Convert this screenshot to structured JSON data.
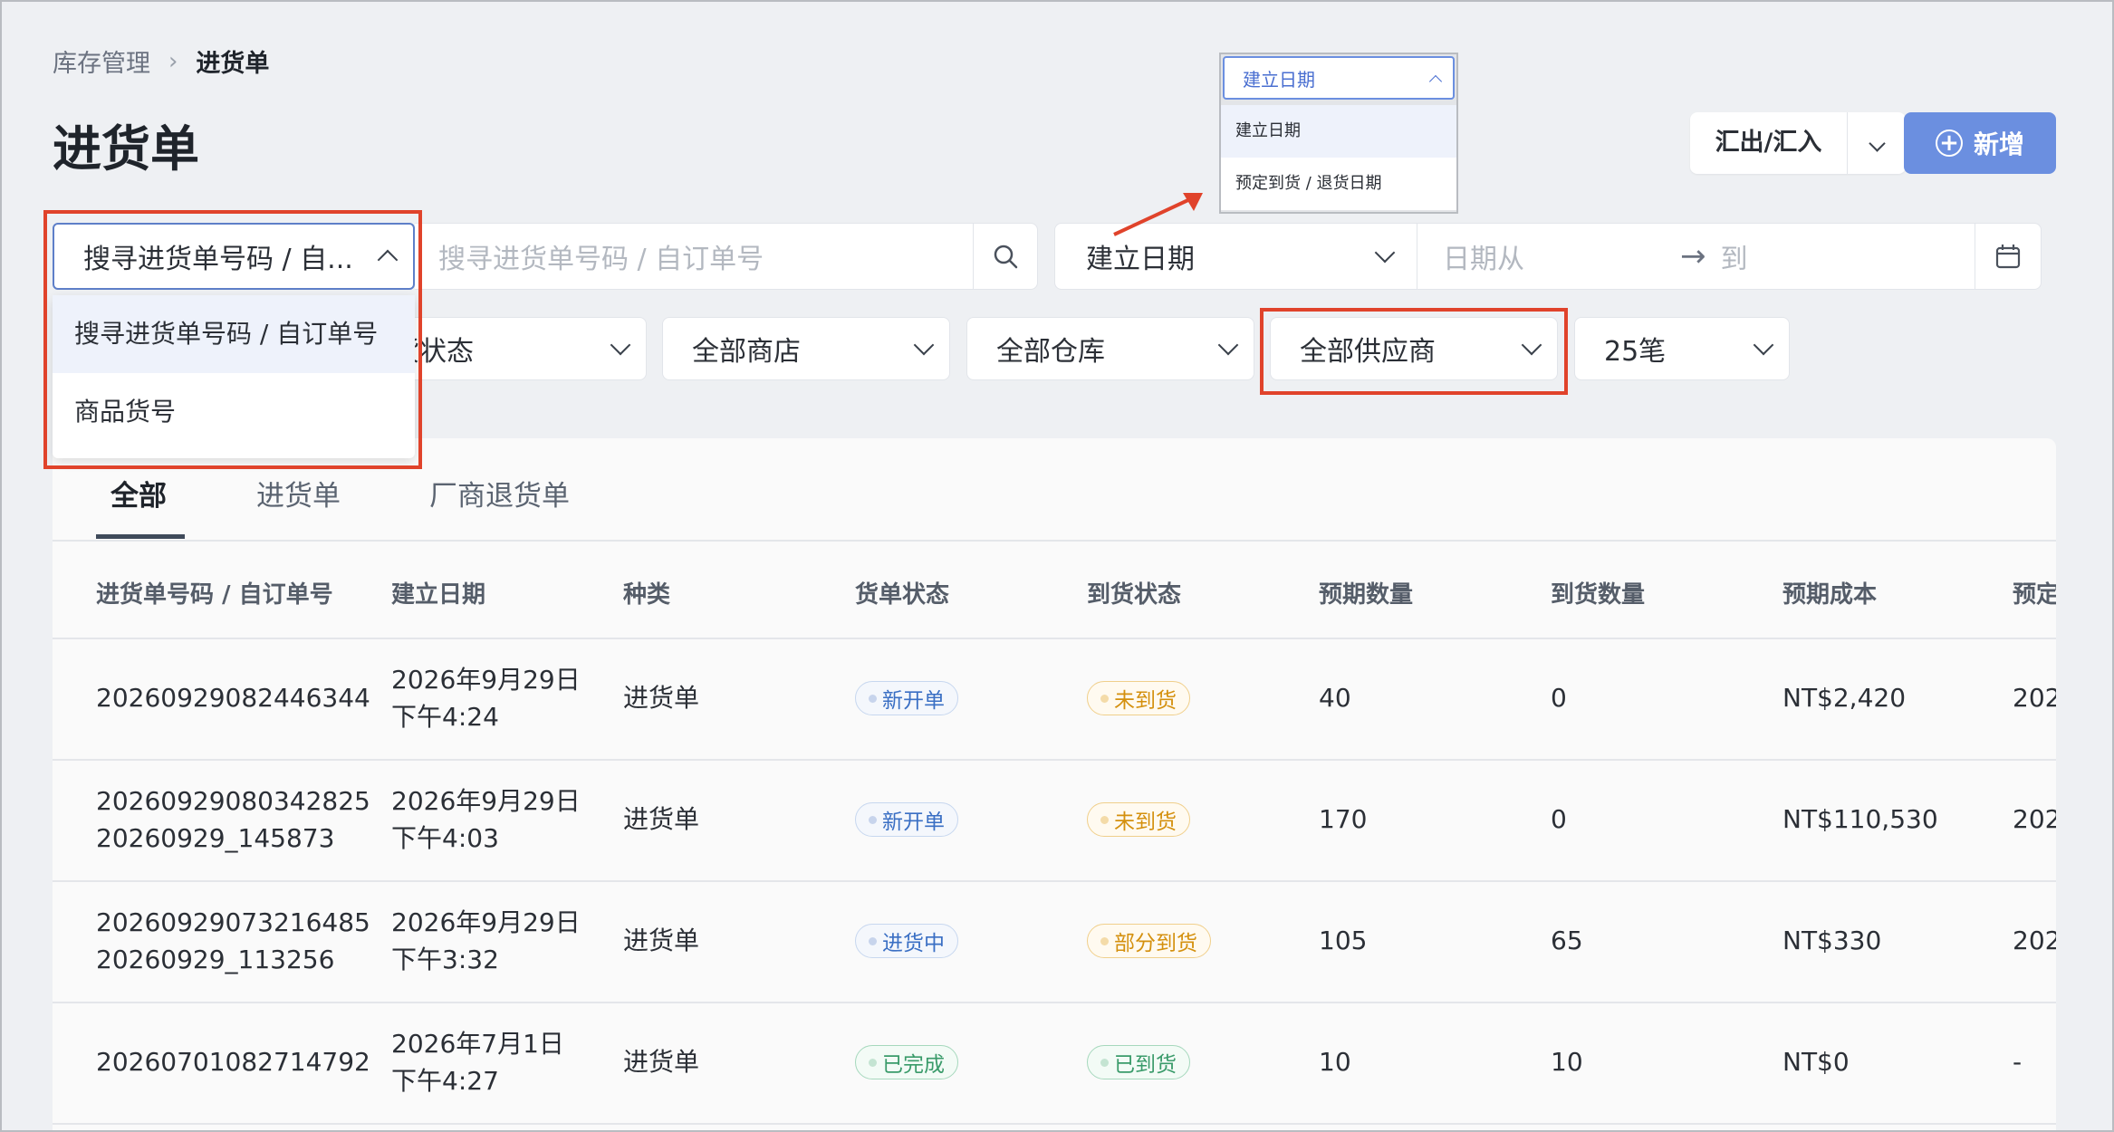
{
  "breadcrumb": {
    "parent": "库存管理",
    "current": "进货单"
  },
  "page_title": "进货单",
  "actions": {
    "export_label": "汇出/汇入",
    "new_label": "新增"
  },
  "search": {
    "type_selected": "搜寻进货单号码 / 自...",
    "placeholder": "搜寻进货单号码 / 自订单号",
    "type_options": [
      "搜寻进货单号码 / 自订单号",
      "商品货号"
    ]
  },
  "date_filter": {
    "type_selected": "建立日期",
    "from_placeholder": "日期从",
    "to_placeholder": "到",
    "options": [
      "建立日期",
      "预定到货 / 退货日期"
    ]
  },
  "filters": {
    "arrival_status": "货状态",
    "store": "全部商店",
    "warehouse": "全部仓库",
    "supplier": "全部供应商",
    "page_size": "25笔"
  },
  "tabs": [
    {
      "label": "全部",
      "active": true
    },
    {
      "label": "进货单",
      "active": false
    },
    {
      "label": "厂商退货单",
      "active": false
    }
  ],
  "table": {
    "headers": [
      "进货单号码 / 自订单号",
      "建立日期",
      "种类",
      "货单状态",
      "到货状态",
      "预期数量",
      "到货数量",
      "预期成本",
      "预定"
    ],
    "rows": [
      {
        "id": "20260929082446344",
        "custom": "",
        "date": "2026年9月29日",
        "time": "下午4:24",
        "type": "进货单",
        "order_status": "新开单",
        "order_status_color": "blue",
        "arrival_status": "未到货",
        "arrival_status_color": "orange",
        "expected_qty": "40",
        "arrived_qty": "0",
        "expected_cost": "NT$2,420",
        "scheduled": "202"
      },
      {
        "id": "20260929080342825",
        "custom": "20260929_145873",
        "date": "2026年9月29日",
        "time": "下午4:03",
        "type": "进货单",
        "order_status": "新开单",
        "order_status_color": "blue",
        "arrival_status": "未到货",
        "arrival_status_color": "orange",
        "expected_qty": "170",
        "arrived_qty": "0",
        "expected_cost": "NT$110,530",
        "scheduled": "202"
      },
      {
        "id": "20260929073216485",
        "custom": "20260929_113256",
        "date": "2026年9月29日",
        "time": "下午3:32",
        "type": "进货单",
        "order_status": "进货中",
        "order_status_color": "blue",
        "arrival_status": "部分到货",
        "arrival_status_color": "orange",
        "expected_qty": "105",
        "arrived_qty": "65",
        "expected_cost": "NT$330",
        "scheduled": "202"
      },
      {
        "id": "20260701082714792",
        "custom": "",
        "date": "2026年7月1日",
        "time": "下午4:27",
        "type": "进货单",
        "order_status": "已完成",
        "order_status_color": "green",
        "arrival_status": "已到货",
        "arrival_status_color": "green",
        "expected_qty": "10",
        "arrived_qty": "10",
        "expected_cost": "NT$0",
        "scheduled": "-"
      }
    ]
  },
  "colors": {
    "accent": "#6b8fe0",
    "highlight": "#e0432b",
    "page_bg": "#eef0f3"
  }
}
